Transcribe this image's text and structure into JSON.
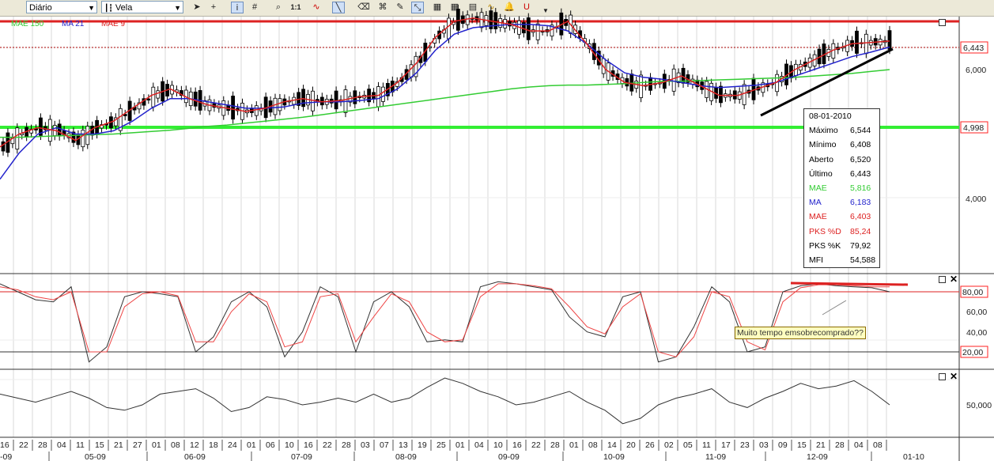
{
  "toolbar": {
    "period_value": "Diário",
    "chart_type_value": "Vela",
    "zoom_label": "1:1",
    "icons": [
      "cursor-icon",
      "crosshair-icon",
      "info-icon",
      "grid-icon",
      "zoom-icon",
      "zoom-1to1-icon",
      "indicator-icon",
      "trendline-icon",
      "eraser-icon",
      "object-icon",
      "drawing-tool-icon",
      "expand-icon",
      "chart-type-1-icon",
      "chart-type-2-icon",
      "chart-type-3-icon",
      "chart-type-4-icon",
      "alert-icon",
      "magnet-icon",
      "more-icon"
    ]
  },
  "legend": [
    {
      "label": "MAE 150",
      "color": "#33cc33"
    },
    {
      "label": "MA 21",
      "color": "#2222cc"
    },
    {
      "label": "MAE 9",
      "color": "#dd2222"
    }
  ],
  "price_axis": {
    "ticks": [
      "6,000",
      "4,000"
    ],
    "last_price": "6,443",
    "support_price": "4,998"
  },
  "tooltip": {
    "date": "08-01-2010",
    "rows": [
      {
        "label": "Máximo",
        "value": "6,544",
        "color": "#000000"
      },
      {
        "label": "Mínimo",
        "value": "6,408",
        "color": "#000000"
      },
      {
        "label": "Aberto",
        "value": "6,520",
        "color": "#000000"
      },
      {
        "label": "Último",
        "value": "6,443",
        "color": "#000000"
      },
      {
        "label": "MAE",
        "value": "5,816",
        "color": "#33cc33"
      },
      {
        "label": "MA",
        "value": "6,183",
        "color": "#2222cc"
      },
      {
        "label": "MAE",
        "value": "6,403",
        "color": "#dd2222"
      },
      {
        "label": "PKS %D",
        "value": "85,24",
        "color": "#dd2222"
      },
      {
        "label": "PKS %K",
        "value": "79,92",
        "color": "#000000"
      },
      {
        "label": "MFI",
        "value": "54,588",
        "color": "#000000"
      }
    ]
  },
  "stoch_axis": {
    "ticks": [
      "60,00",
      "40,00"
    ],
    "upper": "80,00",
    "lower": "20,00"
  },
  "annotation": "Muito tempo emsobrecomprado??",
  "mfi_axis": {
    "ticks": [
      "50,000"
    ]
  },
  "x_axis": {
    "days": [
      "16",
      "22",
      "28",
      "04",
      "11",
      "15",
      "21",
      "27",
      "01",
      "08",
      "12",
      "18",
      "24",
      "01",
      "06",
      "10",
      "16",
      "22",
      "28",
      "03",
      "07",
      "13",
      "19",
      "25",
      "01",
      "04",
      "10",
      "16",
      "22",
      "28",
      "01",
      "08",
      "14",
      "20",
      "26",
      "02",
      "05",
      "11",
      "17",
      "23",
      "03",
      "09",
      "15",
      "21",
      "28",
      "04",
      "08"
    ],
    "months": [
      "05-09",
      "06-09",
      "07-09",
      "08-09",
      "09-09",
      "10-09",
      "11-09",
      "12-09",
      "01-10"
    ],
    "edge_label": "-09"
  },
  "colors": {
    "red": "#dd2222",
    "green": "#33cc33",
    "blue": "#2222cc",
    "toolbar": "#ece9d8",
    "price_box": "#ff2222",
    "grid": "#d8d8d8"
  },
  "chart_data": [
    {
      "type": "candlestick",
      "panel": "price",
      "y_ticks": [
        4000,
        6000
      ],
      "last_price": 6.443,
      "support_level": 4.998,
      "resistance_level": 6.9,
      "series": [
        {
          "name": "MAE 150",
          "values": [
            4.95,
            4.95,
            4.96,
            4.97,
            4.98,
            4.99,
            5.0,
            5.02,
            5.04,
            5.06,
            5.09,
            5.12,
            5.14,
            5.17,
            5.2,
            5.23,
            5.26,
            5.3,
            5.34,
            5.38,
            5.42,
            5.46,
            5.5,
            5.54,
            5.58,
            5.62,
            5.66,
            5.7,
            5.73,
            5.75,
            5.76,
            5.76,
            5.77,
            5.78,
            5.8,
            5.82,
            5.82,
            5.83,
            5.84,
            5.85,
            5.86,
            5.87,
            5.88,
            5.9,
            5.92,
            5.94,
            5.97,
            6.0
          ]
        },
        {
          "name": "MA 21",
          "values": [
            4.3,
            4.7,
            5.0,
            5.1,
            5.0,
            5.0,
            5.05,
            5.2,
            5.4,
            5.55,
            5.55,
            5.5,
            5.45,
            5.4,
            5.4,
            5.42,
            5.48,
            5.5,
            5.5,
            5.52,
            5.55,
            5.7,
            5.95,
            6.3,
            6.55,
            6.65,
            6.68,
            6.7,
            6.7,
            6.68,
            6.6,
            6.4,
            6.15,
            5.95,
            5.88,
            5.85,
            5.8,
            5.75,
            5.72,
            5.74,
            5.76,
            5.8,
            5.9,
            6.0,
            6.1,
            6.2,
            6.27,
            6.35
          ]
        },
        {
          "name": "MAE 9",
          "values": [
            4.8,
            5.0,
            5.1,
            5.05,
            4.9,
            5.1,
            5.2,
            5.4,
            5.6,
            5.7,
            5.55,
            5.45,
            5.4,
            5.35,
            5.4,
            5.5,
            5.55,
            5.5,
            5.52,
            5.58,
            5.6,
            5.8,
            6.1,
            6.5,
            6.75,
            6.8,
            6.75,
            6.7,
            6.6,
            6.6,
            6.75,
            6.4,
            6.0,
            5.8,
            5.75,
            5.8,
            5.9,
            5.75,
            5.6,
            5.6,
            5.7,
            5.8,
            6.0,
            6.15,
            6.3,
            6.4,
            6.42,
            6.443
          ]
        }
      ]
    },
    {
      "type": "line",
      "panel": "stochastic",
      "y_ticks": [
        40,
        60
      ],
      "bands": [
        20,
        80
      ],
      "series": [
        {
          "name": "PKS %K",
          "values": [
            88,
            80,
            72,
            70,
            85,
            10,
            25,
            75,
            80,
            78,
            75,
            20,
            35,
            70,
            80,
            65,
            15,
            40,
            85,
            75,
            20,
            70,
            80,
            65,
            30,
            32,
            30,
            85,
            90,
            88,
            85,
            82,
            55,
            40,
            35,
            75,
            80,
            10,
            15,
            45,
            85,
            70,
            20,
            25,
            80,
            86,
            88,
            86,
            85,
            84,
            80
          ]
        },
        {
          "name": "PKS %D",
          "values": [
            85,
            82,
            75,
            72,
            80,
            20,
            20,
            65,
            78,
            80,
            76,
            30,
            30,
            60,
            78,
            70,
            25,
            30,
            75,
            78,
            30,
            55,
            78,
            70,
            40,
            30,
            32,
            75,
            88,
            88,
            86,
            83,
            65,
            45,
            38,
            65,
            78,
            20,
            15,
            35,
            80,
            75,
            30,
            22,
            70,
            84,
            87,
            87,
            86,
            85,
            85
          ]
        }
      ]
    },
    {
      "type": "line",
      "panel": "mfi",
      "y_ticks": [
        50
      ],
      "series": [
        {
          "name": "MFI",
          "values": [
            58,
            55,
            52,
            56,
            60,
            55,
            48,
            46,
            50,
            58,
            60,
            62,
            55,
            45,
            48,
            56,
            54,
            50,
            52,
            55,
            52,
            58,
            52,
            55,
            63,
            70,
            66,
            60,
            56,
            50,
            52,
            56,
            60,
            52,
            46,
            36,
            40,
            50,
            55,
            58,
            62,
            52,
            48,
            55,
            60,
            66,
            62,
            64,
            68,
            60,
            50
          ]
        }
      ]
    }
  ]
}
